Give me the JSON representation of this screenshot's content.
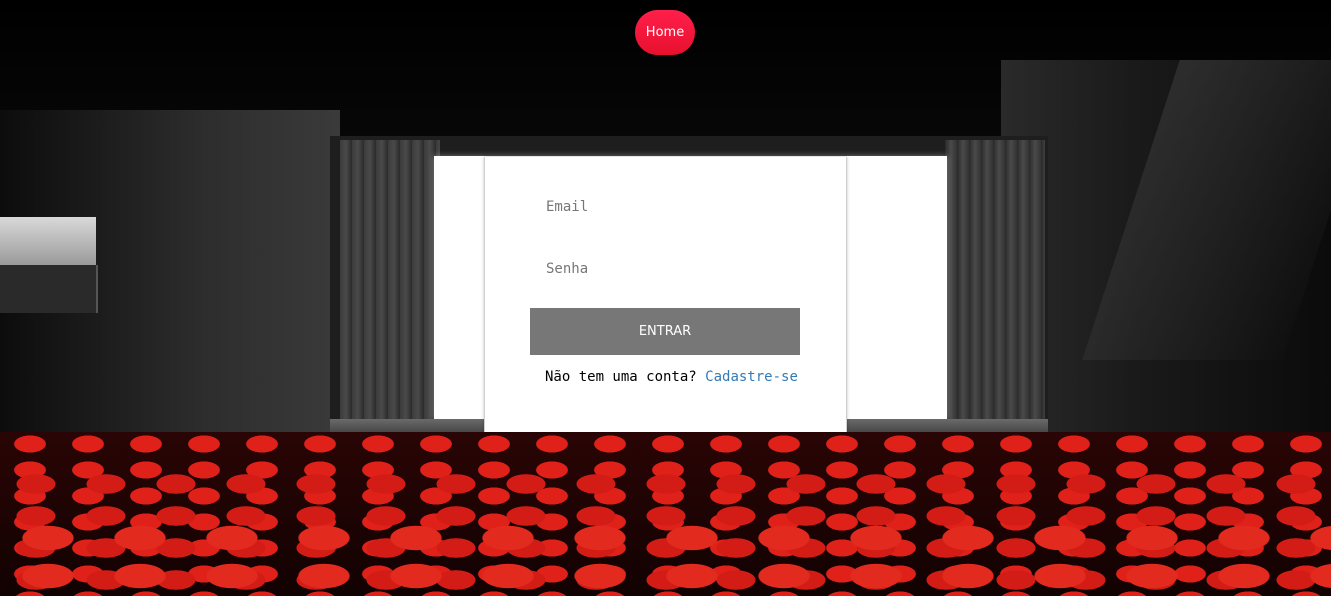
{
  "nav": {
    "home_label": "Home"
  },
  "login": {
    "email_placeholder": "Email",
    "password_placeholder": "Senha",
    "submit_label": "ENTRAR",
    "signup_prompt": "Não tem uma conta?",
    "signup_link": "Cadastre-se"
  },
  "colors": {
    "home_button": "#e8102e",
    "submit_button": "#777777",
    "link": "#337ab7"
  }
}
